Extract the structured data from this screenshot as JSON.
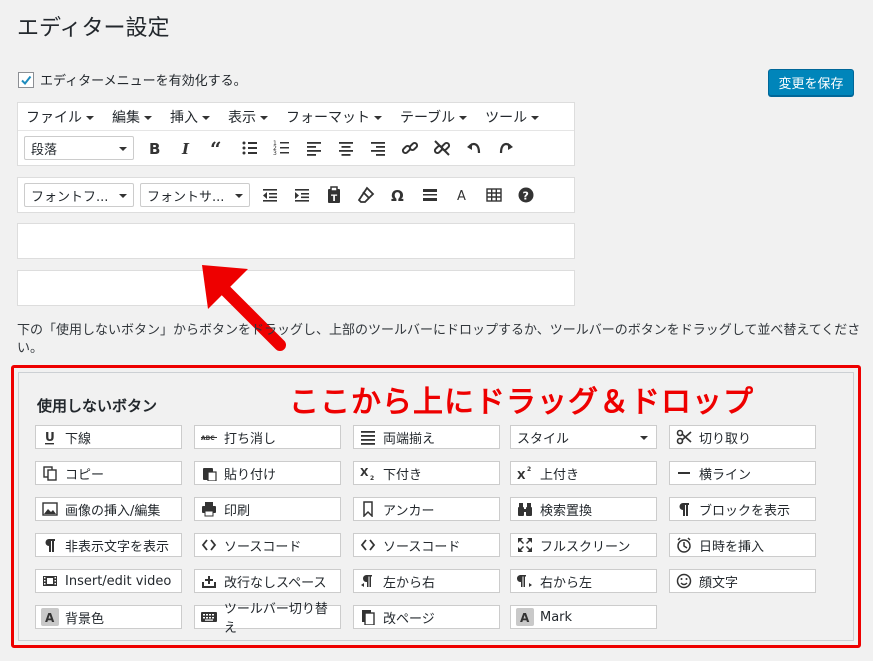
{
  "page": {
    "title": "エディター設定"
  },
  "enable": {
    "label": "エディターメニューを有効化する。",
    "checked": true
  },
  "save_button": "変更を保存",
  "menubar": [
    "ファイル",
    "編集",
    "挿入",
    "表示",
    "フォーマット",
    "テーブル",
    "ツール"
  ],
  "toolbar1": {
    "format_select": "段落",
    "buttons": [
      "bold-icon",
      "italic-icon",
      "blockquote-icon",
      "bullet-list-icon",
      "numbered-list-icon",
      "align-left-icon",
      "align-center-icon",
      "align-right-icon",
      "link-icon",
      "unlink-icon",
      "undo-icon",
      "redo-icon"
    ]
  },
  "toolbar2": {
    "font_family_select": "フォントフ...",
    "font_size_select": "フォントサ...",
    "buttons": [
      "outdent-icon",
      "indent-icon",
      "paste-text-icon",
      "eraser-icon",
      "omega-icon",
      "horizontal-rule-icon",
      "text-color-icon",
      "table-icon",
      "help-icon"
    ]
  },
  "hint": "下の「使用しないボタン」からボタンをドラッグし、上部のツールバーにドロップするか、ツールバーのボタンをドラッグして並べ替えてください。",
  "unused": {
    "title": "使用しないボタン",
    "note": "ここから上にドラッグ＆ドロップ",
    "items": [
      {
        "label": "下線",
        "icon": "underline-icon"
      },
      {
        "label": "打ち消し",
        "icon": "strikethrough-icon"
      },
      {
        "label": "両端揃え",
        "icon": "justify-icon"
      },
      {
        "label": "スタイル",
        "icon": "dropdown"
      },
      {
        "label": "切り取り",
        "icon": "scissors-icon"
      },
      {
        "label": "コピー",
        "icon": "copy-icon"
      },
      {
        "label": "貼り付け",
        "icon": "paste-icon"
      },
      {
        "label": "下付き",
        "icon": "subscript-icon"
      },
      {
        "label": "上付き",
        "icon": "superscript-icon"
      },
      {
        "label": "横ライン",
        "icon": "horizontal-line-icon"
      },
      {
        "label": "画像の挿入/編集",
        "icon": "image-icon"
      },
      {
        "label": "印刷",
        "icon": "print-icon"
      },
      {
        "label": "アンカー",
        "icon": "bookmark-icon"
      },
      {
        "label": "検索置換",
        "icon": "binoculars-icon"
      },
      {
        "label": "ブロックを表示",
        "icon": "pilcrow-icon"
      },
      {
        "label": "非表示文字を表示",
        "icon": "pilcrow-icon"
      },
      {
        "label": "ソースコード",
        "icon": "code-icon"
      },
      {
        "label": "ソースコード",
        "icon": "code-icon"
      },
      {
        "label": "フルスクリーン",
        "icon": "fullscreen-icon"
      },
      {
        "label": "日時を挿入",
        "icon": "clock-icon"
      },
      {
        "label": "Insert/edit video",
        "icon": "video-icon"
      },
      {
        "label": "改行なしスペース",
        "icon": "nonbreaking-icon"
      },
      {
        "label": "左から右",
        "icon": "ltr-icon"
      },
      {
        "label": "右から左",
        "icon": "rtl-icon"
      },
      {
        "label": "顔文字",
        "icon": "smiley-icon"
      },
      {
        "label": "背景色",
        "icon": "background-color-icon"
      },
      {
        "label": "ツールバー切り替え",
        "icon": "keyboard-icon"
      },
      {
        "label": "改ページ",
        "icon": "page-break-icon"
      },
      {
        "label": "Mark",
        "icon": "mark-icon"
      }
    ]
  },
  "colors": {
    "accent": "#0085ba",
    "annotation": "#ee0000"
  }
}
